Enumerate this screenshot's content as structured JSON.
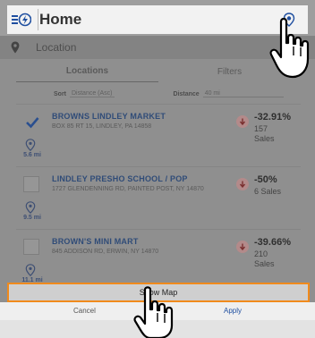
{
  "header": {
    "menu_icon": "menu-logo-icon",
    "title": "Home",
    "location_button_icon": "location-target-icon"
  },
  "location": {
    "icon": "map-pin-icon",
    "placeholder": "Location"
  },
  "tabs": [
    {
      "label": "Locations",
      "active": true
    },
    {
      "label": "Filters",
      "active": false
    }
  ],
  "sort": {
    "label": "Sort",
    "value": "Distance (Asc)",
    "distance_label": "Distance",
    "distance_value": "40 mi"
  },
  "items": [
    {
      "checked": true,
      "name": "BROWNS LINDLEY MARKET",
      "address": "BOX 85 RT 15, LINDLEY, PA 14858",
      "distance": "5.6 mi",
      "change": "-32.91%",
      "sales_count": "157",
      "sales_label": "Sales",
      "trend_icon": "trend-down-icon"
    },
    {
      "checked": false,
      "name": "LINDLEY PRESHO SCHOOL / POP",
      "address": "1727 GLENDENNING RD, PAINTED POST, NY 14870",
      "distance": "9.5 mi",
      "change": "-50%",
      "sales_count": "6",
      "sales_label": "Sales",
      "trend_icon": "trend-down-icon"
    },
    {
      "checked": false,
      "name": "BROWN'S MINI MART",
      "address": "845 ADDISON RD, ERWIN, NY 14870",
      "distance": "11.1 mi",
      "change": "-39.66%",
      "sales_count": "210",
      "sales_label": "Sales",
      "trend_icon": "trend-down-icon"
    }
  ],
  "show_map_label": "Show Map",
  "footer": {
    "cancel_label": "Cancel",
    "apply_label": "Apply"
  },
  "colors": {
    "accent": "#1f4fa0",
    "highlight": "#f08a1c",
    "name_text": "#304c78"
  }
}
